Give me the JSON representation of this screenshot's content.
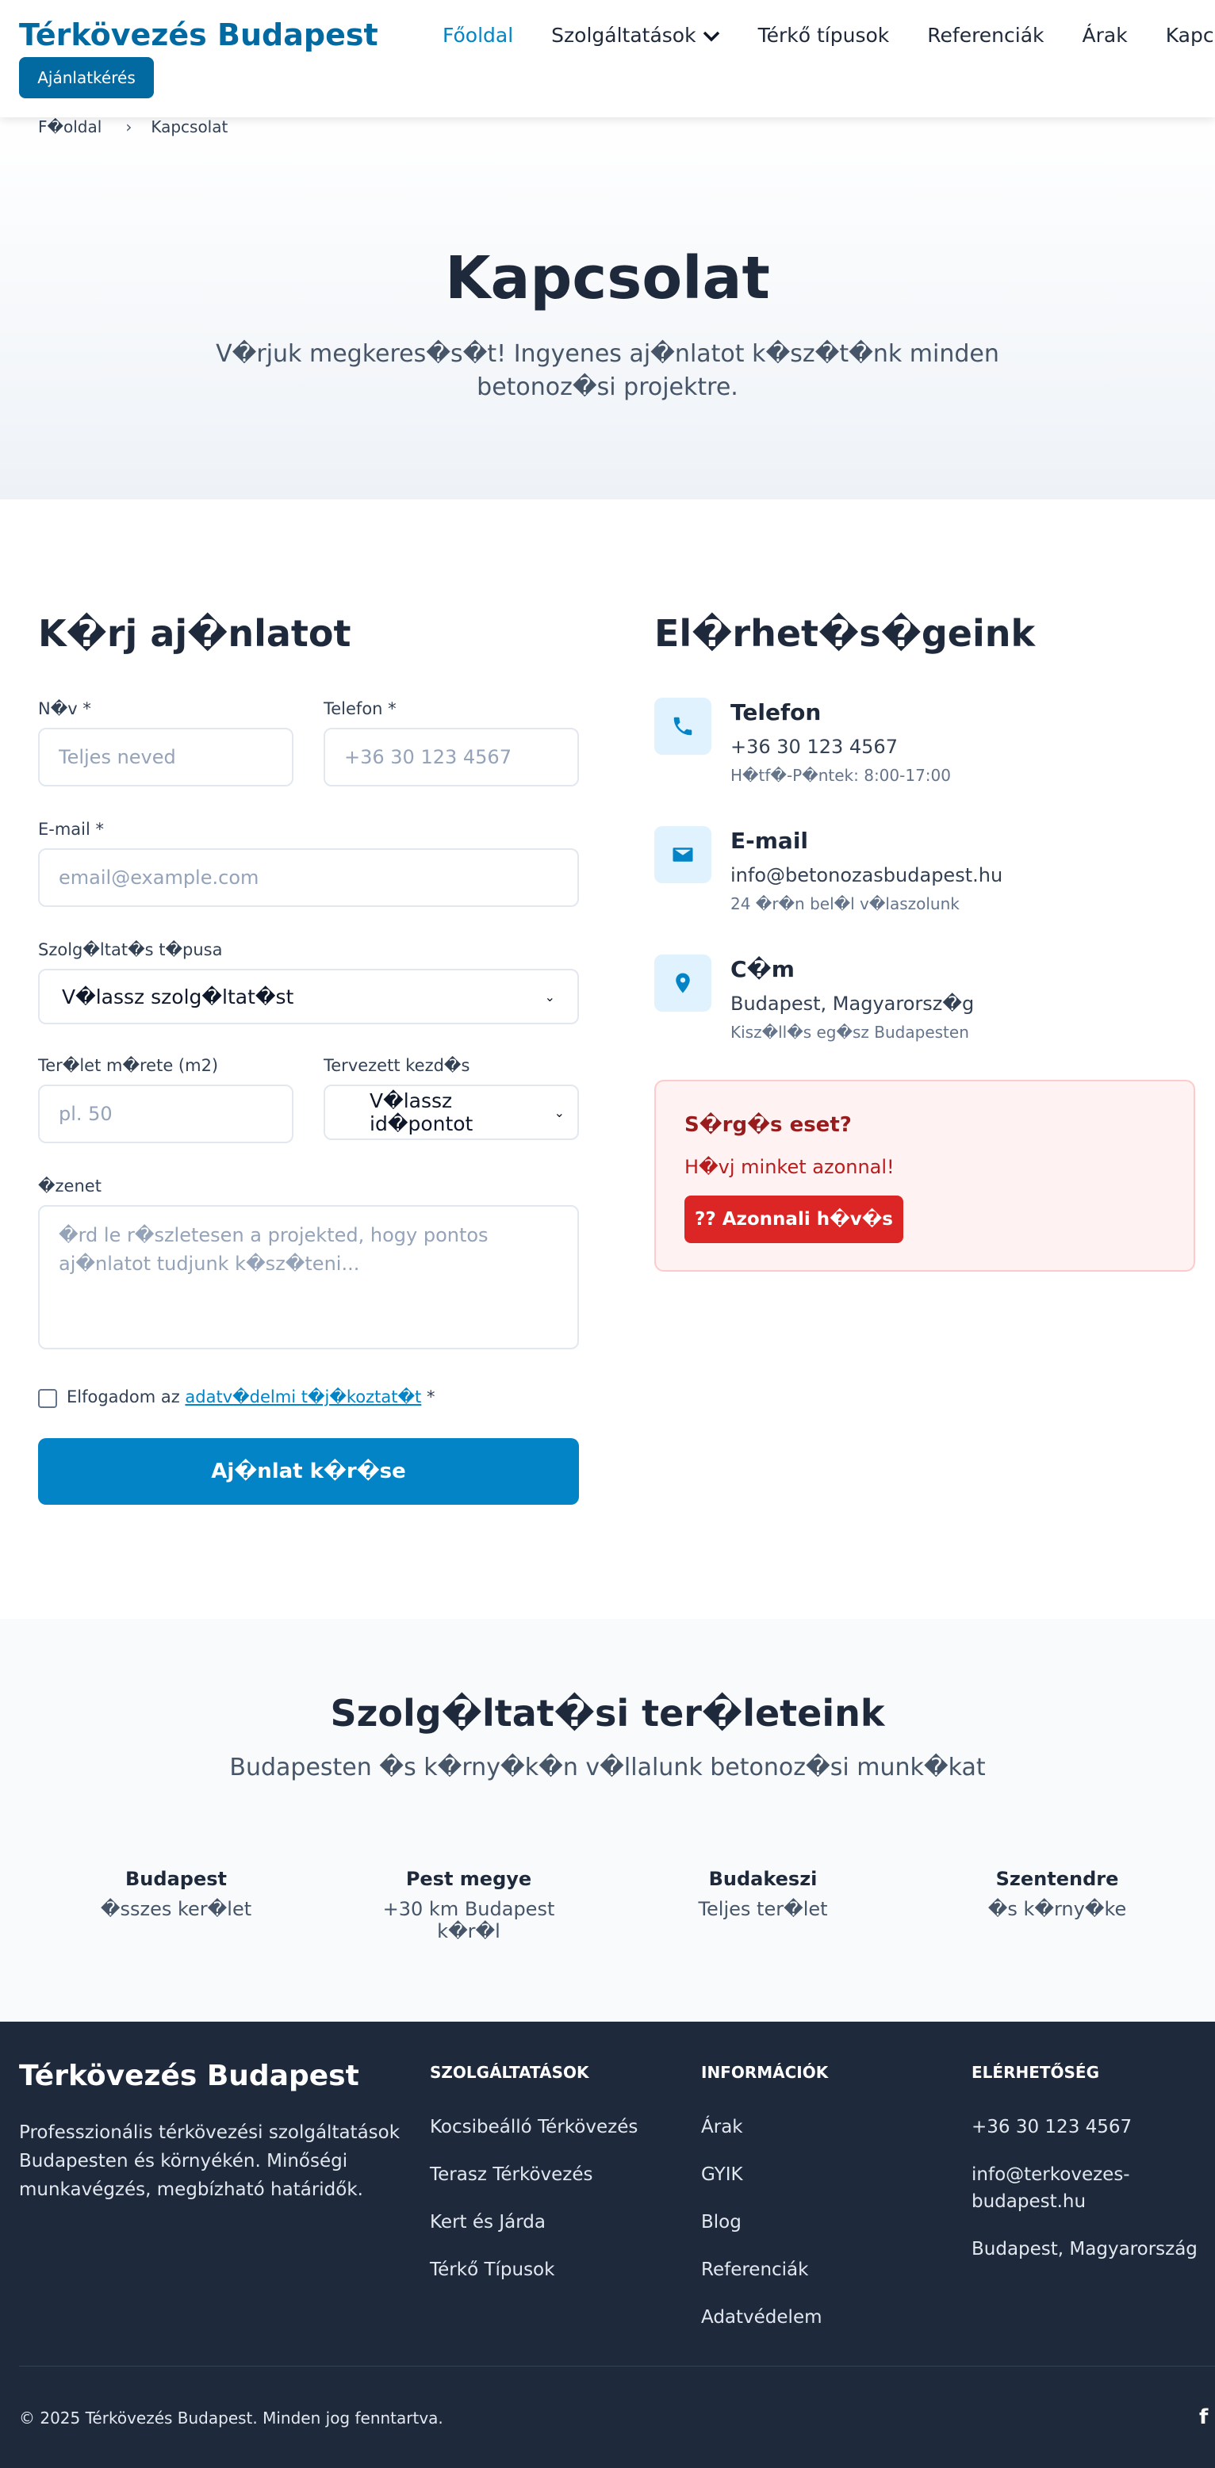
{
  "header": {
    "logo": "Térkövezés Budapest",
    "quote_button": "Ajánlatkérés",
    "nav": [
      "Főoldal",
      "Szolgáltatások",
      "Térkő típusok",
      "Referenciák",
      "Árak",
      "Kapcsolat"
    ]
  },
  "breadcrumb": {
    "home": "F�oldal",
    "current": "Kapcsolat"
  },
  "hero": {
    "title": "Kapcsolat",
    "subtitle": "V�rjuk megkeres�s�t! Ingyenes aj�nlatot k�sz�t�nk minden betonoz�si projektre."
  },
  "form": {
    "title": "K�rj aj�nlatot",
    "name_label": "N�v *",
    "name_placeholder": "Teljes neved",
    "phone_label": "Telefon *",
    "phone_placeholder": "+36 30 123 4567",
    "email_label": "E-mail *",
    "email_placeholder": "email@example.com",
    "service_label": "Szolg�ltat�s t�pusa",
    "service_value": "V�lassz szolg�ltat�st",
    "area_label": "Ter�let m�rete (m2)",
    "area_placeholder": "pl. 50",
    "start_label": "Tervezett kezd�s",
    "start_value": "V�lassz id�pontot",
    "message_label": "�zenet",
    "message_placeholder": "�rd le r�szletesen a projekted, hogy pontos aj�nlatot tudjunk k�sz�teni...",
    "consent_prefix": "Elfogadom az ",
    "consent_link": "adatv�delmi t�j�koztat�t",
    "consent_suffix": " *",
    "submit": "Aj�nlat k�r�se"
  },
  "contact": {
    "title": "El�rhet�s�geink",
    "items": [
      {
        "icon": "phone-icon",
        "head": "Telefon",
        "value": "+36 30 123 4567",
        "note": "H�tf�-P�ntek: 8:00-17:00"
      },
      {
        "icon": "mail-icon",
        "head": "E-mail",
        "value": "info@betonozasbudapest.hu",
        "note": "24 �r�n bel�l v�laszolunk"
      },
      {
        "icon": "location-pin-icon",
        "head": "C�m",
        "value": "Budapest, Magyarorsz�g",
        "note": "Kisz�ll�s eg�sz Budapesten"
      }
    ],
    "urgent": {
      "title": "S�rg�s eset?",
      "text": "H�vj minket azonnal!",
      "button": "?? Azonnali h�v�s"
    }
  },
  "areas": {
    "title": "Szolg�ltat�si ter�leteink",
    "subtitle": "Budapesten �s k�rny�k�n v�llalunk betonoz�si munk�kat",
    "items": [
      {
        "name": "Budapest",
        "desc": "�sszes ker�let"
      },
      {
        "name": "Pest megye",
        "desc": "+30 km Budapest k�r�l"
      },
      {
        "name": "Budakeszi",
        "desc": "Teljes ter�let"
      },
      {
        "name": "Szentendre",
        "desc": "�s k�rny�ke"
      }
    ]
  },
  "footer": {
    "logo": "Térkövezés Budapest",
    "description": "Professzionális térkövezési szolgáltatások Budapesten és környékén. Minőségi munkavégzés, megbízható határidők.",
    "col1": {
      "title": "SZOLGÁLTATÁSOK",
      "links": [
        "Kocsibeálló Térkövezés",
        "Terasz Térkövezés",
        "Kert és Járda",
        "Térkő Típusok"
      ]
    },
    "col2": {
      "title": "INFORMÁCIÓK",
      "links": [
        "Árak",
        "GYIK",
        "Blog",
        "Referenciák",
        "Adatvédelem"
      ]
    },
    "col3": {
      "title": "ELÉRHETŐSÉG",
      "links": [
        "+36 30 123 4567",
        "info@terkovezes-budapest.hu",
        "Budapest, Magyarország"
      ]
    },
    "copyright": "© 2025 Térkövezés Budapest. Minden jog fenntartva.",
    "social": "f"
  },
  "colors": {
    "primary": "#0284c7",
    "dark": "#1e293b",
    "danger": "#dc2626"
  }
}
